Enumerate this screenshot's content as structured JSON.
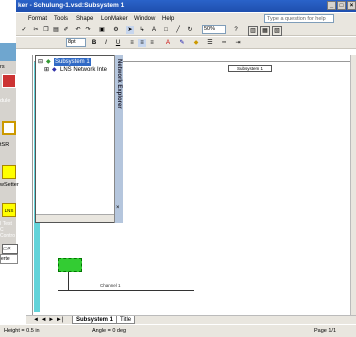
{
  "window": {
    "title": "ker - Schulung-1.vsd:Subsystem 1",
    "controls": [
      "_",
      "□",
      "×"
    ]
  },
  "menu": {
    "items": [
      "Format",
      "Tools",
      "Shape",
      "LonMaker",
      "Window",
      "Help"
    ],
    "help_placeholder": "Type a question for help"
  },
  "toolbar": {
    "zoom": "50%",
    "font_size": "8pt",
    "bold": "B",
    "italic": "I",
    "underline": "U"
  },
  "left_panel": {
    "labels": [
      "rs",
      "dule",
      "tSR",
      "wSetter",
      "erte",
      "I Test C Contro"
    ]
  },
  "explorer": {
    "title": "Network Explorer",
    "root": "Subsystem 1",
    "child": "LNS Network Inte"
  },
  "drawing": {
    "page_label": "Subsystem 1",
    "channel_label": "Channel 1"
  },
  "tabs": {
    "nav": "◄ ◄ ► ►|",
    "active": "Subsystem 1",
    "other": "Title"
  },
  "status": {
    "height": "Height = 0.5 in",
    "angle": "Angle = 0 deg",
    "page": "Page 1/1"
  }
}
